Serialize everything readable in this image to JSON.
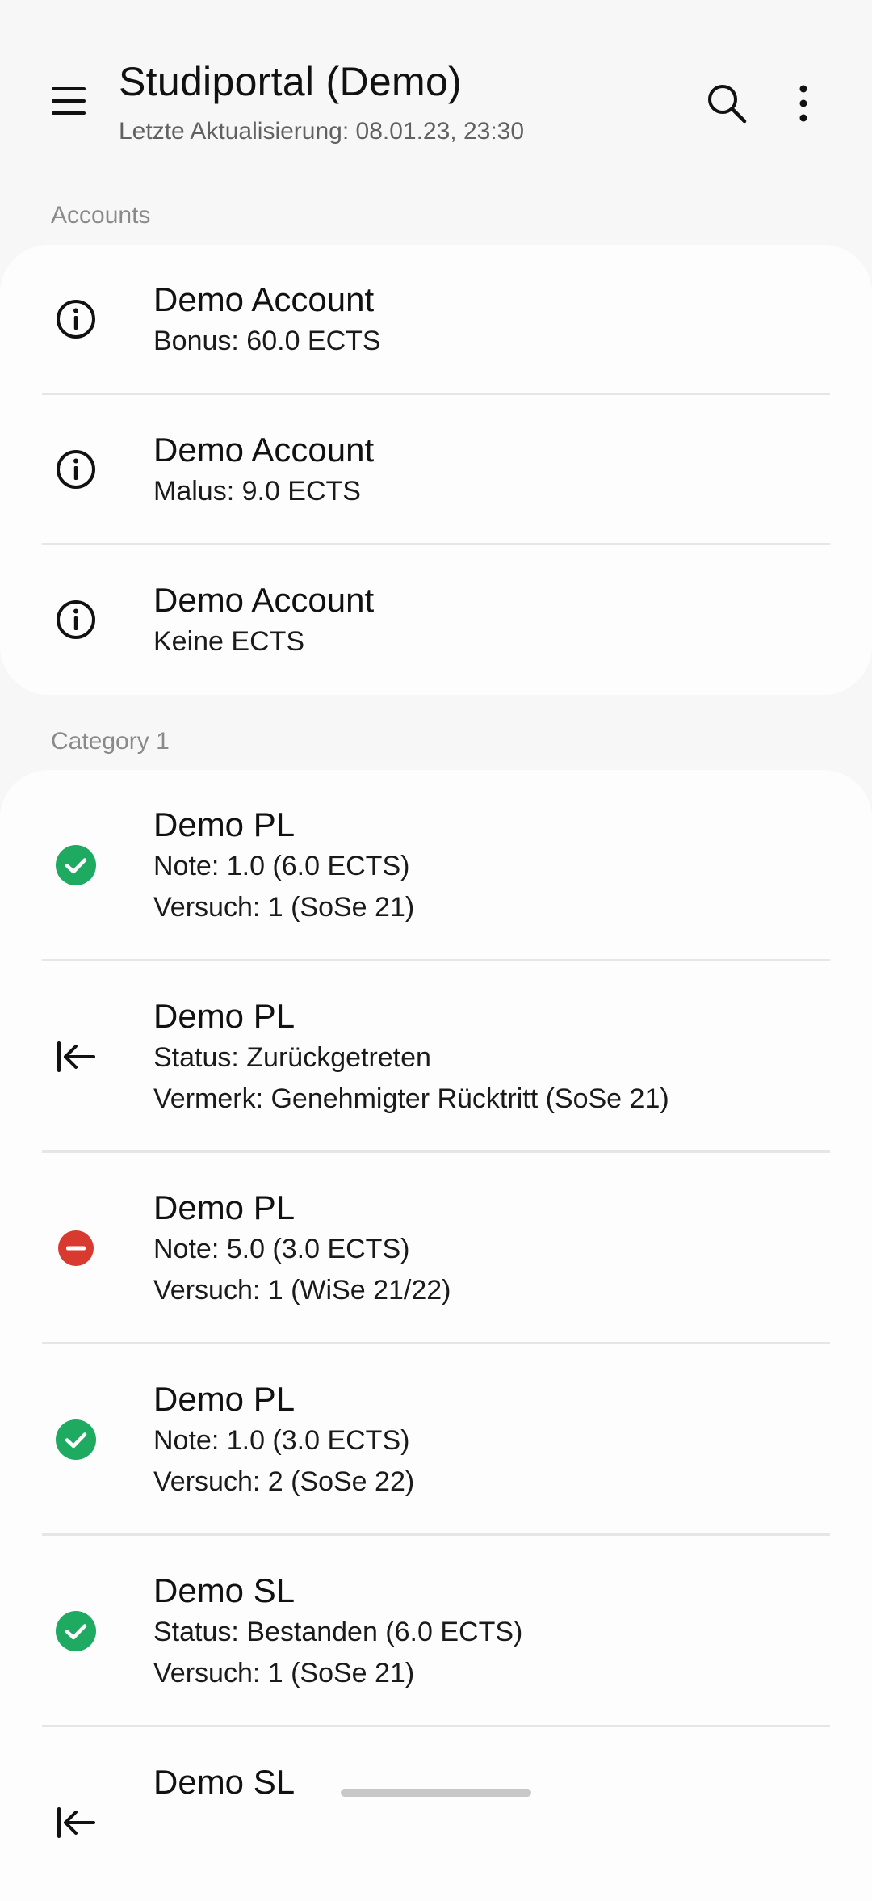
{
  "header": {
    "title": "Studiportal (Demo)",
    "subtitle": "Letzte Aktualisierung: 08.01.23, 23:30"
  },
  "sections": {
    "accounts": {
      "label": "Accounts",
      "items": [
        {
          "title": "Demo Account",
          "line1": "Bonus: 60.0 ECTS",
          "icon": "info-icon"
        },
        {
          "title": "Demo Account",
          "line1": "Malus: 9.0 ECTS",
          "icon": "info-icon"
        },
        {
          "title": "Demo Account",
          "line1": "Keine ECTS",
          "icon": "info-icon"
        }
      ]
    },
    "category1": {
      "label": "Category 1",
      "items": [
        {
          "title": "Demo PL",
          "line1": "Note: 1.0 (6.0 ECTS)",
          "line2": "Versuch: 1 (SoSe 21)",
          "icon": "check-circle-icon"
        },
        {
          "title": "Demo PL",
          "line1": "Status: Zurückgetreten",
          "line2": "Vermerk: Genehmigter Rücktritt (SoSe 21)",
          "icon": "withdraw-arrow-icon"
        },
        {
          "title": "Demo PL",
          "line1": "Note: 5.0 (3.0 ECTS)",
          "line2": "Versuch: 1 (WiSe 21/22)",
          "icon": "minus-circle-icon"
        },
        {
          "title": "Demo PL",
          "line1": "Note: 1.0 (3.0 ECTS)",
          "line2": "Versuch: 2 (SoSe 22)",
          "icon": "check-circle-icon"
        },
        {
          "title": "Demo SL",
          "line1": "Status: Bestanden (6.0 ECTS)",
          "line2": "Versuch: 1 (SoSe 21)",
          "icon": "check-circle-icon"
        },
        {
          "title": "Demo SL",
          "icon": "withdraw-arrow-icon"
        }
      ]
    }
  },
  "colors": {
    "success": "#1faa62",
    "error": "#d83a2f",
    "background": "#f7f7f7",
    "card": "#fdfdfd"
  }
}
